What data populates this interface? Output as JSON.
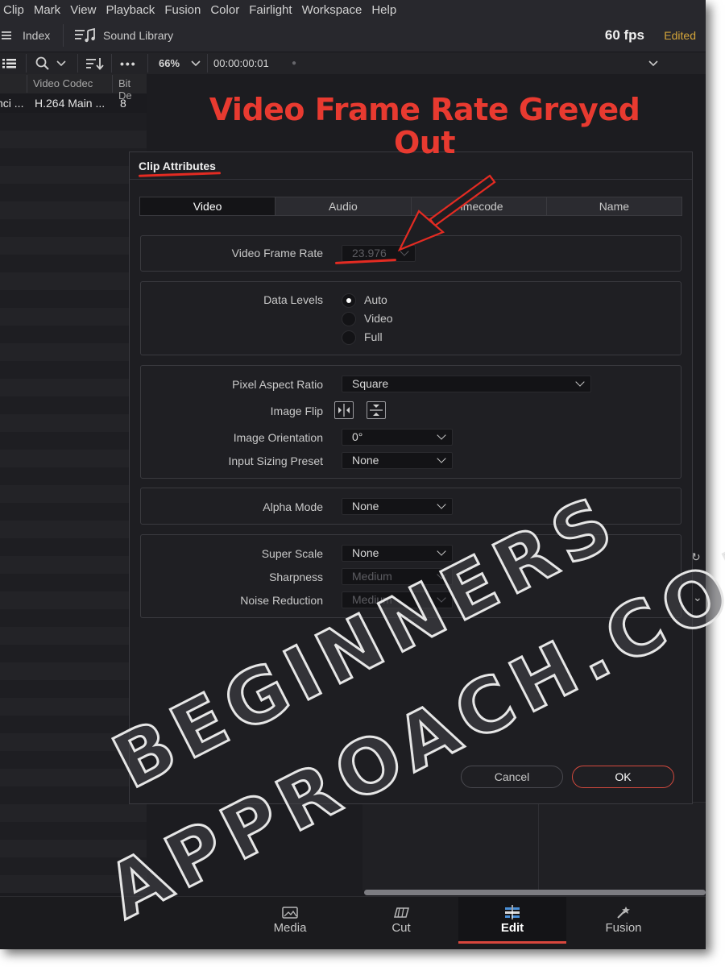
{
  "menu": [
    "Clip",
    "Mark",
    "View",
    "Playback",
    "Fusion",
    "Color",
    "Fairlight",
    "Workspace",
    "Help"
  ],
  "toolbar": {
    "index_label": "Index",
    "sound_library_label": "Sound Library",
    "fps": "60 fps",
    "status": "Edited"
  },
  "bar2": {
    "zoom": "66%",
    "timecode": "00:00:00:01"
  },
  "media_pool": {
    "columns": [
      "Video Codec",
      "Bit De"
    ],
    "row": {
      "name_fragment": "nci ...",
      "codec": "H.264 Main ...",
      "bit_depth": "8"
    }
  },
  "annotation": {
    "headline": "Video Frame Rate Greyed Out"
  },
  "dialog": {
    "title": "Clip Attributes",
    "tabs": [
      "Video",
      "Audio",
      "Timecode",
      "Name"
    ],
    "active_tab": "Video",
    "video_frame_rate": {
      "label": "Video Frame Rate",
      "value": "23.976",
      "disabled": true
    },
    "data_levels": {
      "label": "Data Levels",
      "options": [
        "Auto",
        "Video",
        "Full"
      ],
      "selected": "Auto"
    },
    "pixel_aspect_ratio": {
      "label": "Pixel Aspect Ratio",
      "value": "Square"
    },
    "image_flip": {
      "label": "Image Flip"
    },
    "image_orientation": {
      "label": "Image Orientation",
      "value": "0°"
    },
    "input_sizing_preset": {
      "label": "Input Sizing Preset",
      "value": "None"
    },
    "alpha_mode": {
      "label": "Alpha Mode",
      "value": "None"
    },
    "super_scale": {
      "label": "Super Scale",
      "value": "None"
    },
    "sharpness": {
      "label": "Sharpness",
      "value": "Medium",
      "disabled": true
    },
    "noise_reduction": {
      "label": "Noise Reduction",
      "value": "Medium",
      "disabled": true
    },
    "cancel_label": "Cancel",
    "ok_label": "OK"
  },
  "pages": [
    "Media",
    "Cut",
    "Edit",
    "Fusion"
  ],
  "active_page": "Edit",
  "watermark": {
    "line1": "BEGINNERS",
    "line2": "APPROACH.COM"
  },
  "colors": {
    "accent_red": "#e83a30",
    "edited": "#d4a53a",
    "background": "#1f1f23"
  }
}
